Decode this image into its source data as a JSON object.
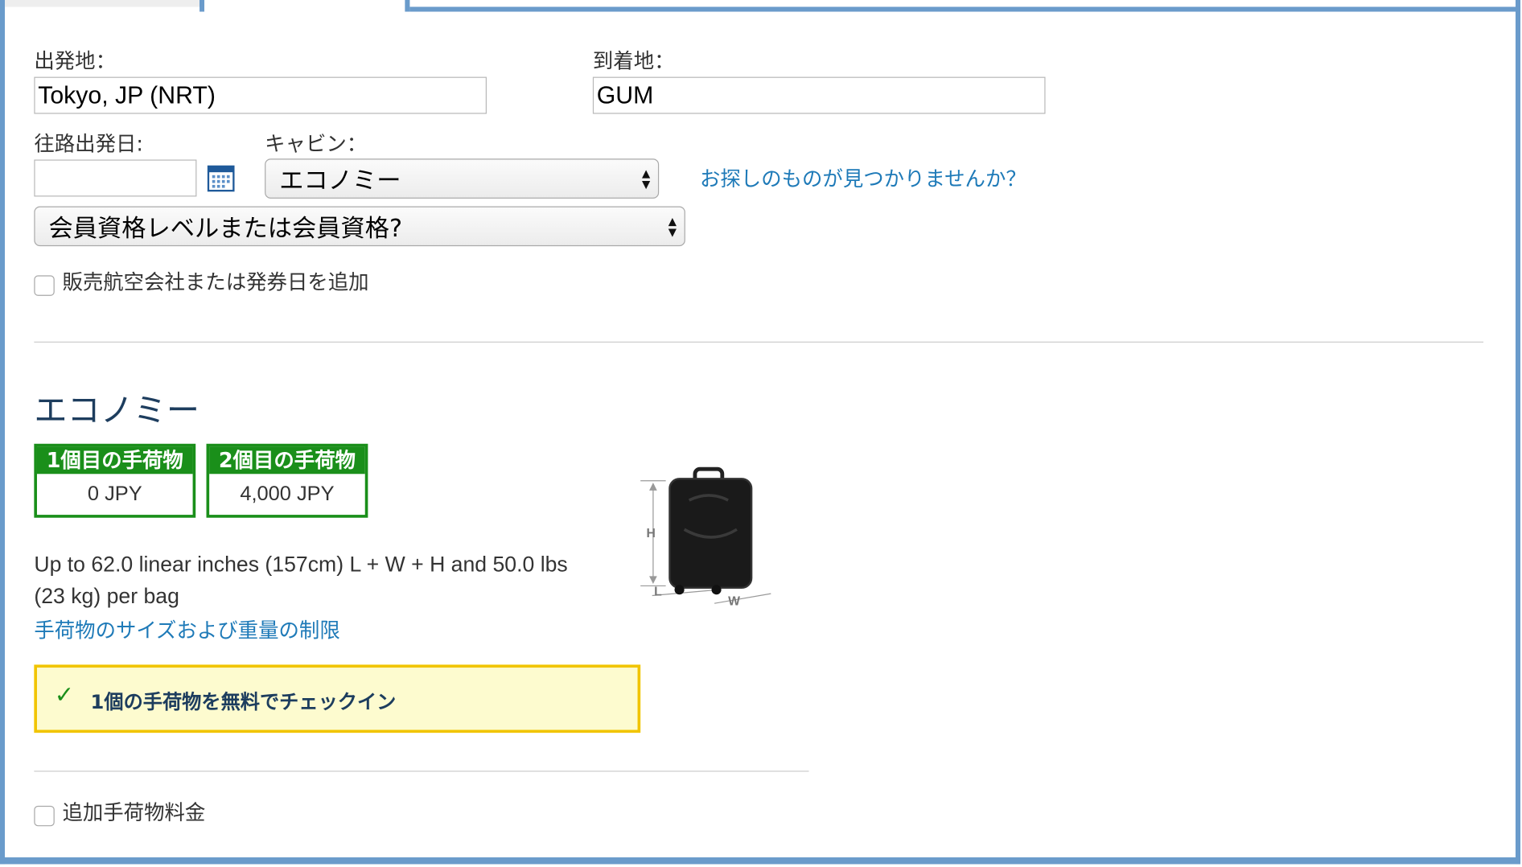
{
  "form": {
    "origin_label": "出発地：",
    "origin_value": "Tokyo, JP (NRT)",
    "destination_label": "到着地：",
    "destination_value": "GUM",
    "departure_date_label": "往路出発日:",
    "departure_date_value": "",
    "cabin_label": "キャビン：",
    "cabin_selected": "エコノミー",
    "help_link": "お探しのものが見つかりませんか？",
    "membership_selected": "会員資格レベルまたは会員資格?",
    "add_carrier_label": "販売航空会社または発券日を追加"
  },
  "results": {
    "cabin_title": "エコノミー",
    "fees": [
      {
        "label": "1個目の手荷物",
        "value": "0 JPY"
      },
      {
        "label": "2個目の手荷物",
        "value": "4,000 JPY"
      }
    ],
    "size_line1": "Up to 62.0 linear inches (157cm) L + W + H and 50.0 lbs",
    "size_line2": "(23 kg) per bag",
    "limits_link": "手荷物のサイズおよび重量の制限",
    "free_notice": "1個の手荷物を無料でチェックイン",
    "extra_fees_label": "追加手荷物料金",
    "suitcase_labels": {
      "h": "H",
      "l": "L",
      "w": "W"
    }
  },
  "colors": {
    "frame": "#6a9bcb",
    "link": "#1e7ab8",
    "fee_green": "#1a8f1a",
    "notice_border": "#f1c400",
    "notice_bg": "#fdfbcf",
    "title_navy": "#1d3d5e"
  }
}
